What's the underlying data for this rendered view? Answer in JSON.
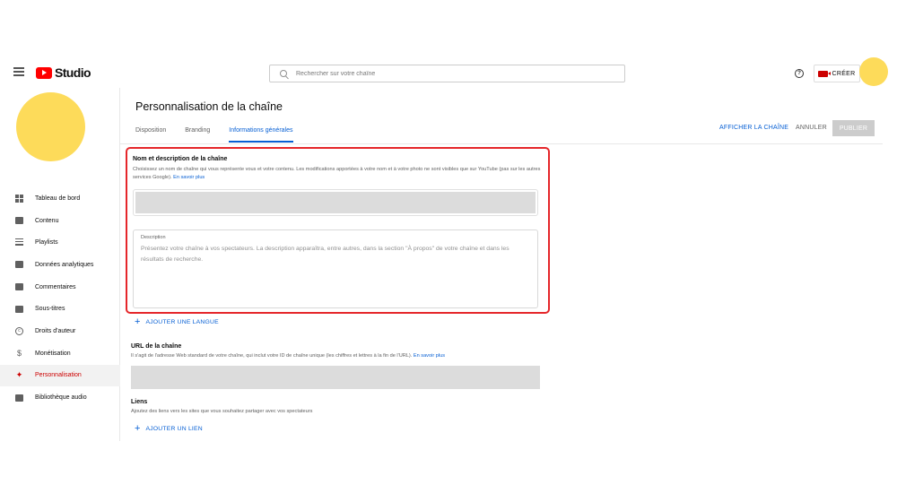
{
  "header": {
    "logo_text": "Studio",
    "search_placeholder": "Rechercher sur votre chaîne",
    "help_glyph": "?",
    "create_label": "CRÉER"
  },
  "sidebar": {
    "items": [
      {
        "label": "Tableau de bord",
        "icon": "dashboard-icon"
      },
      {
        "label": "Contenu",
        "icon": "content-icon"
      },
      {
        "label": "Playlists",
        "icon": "playlists-icon"
      },
      {
        "label": "Données analytiques",
        "icon": "analytics-icon"
      },
      {
        "label": "Commentaires",
        "icon": "comments-icon"
      },
      {
        "label": "Sous-titres",
        "icon": "subtitles-icon"
      },
      {
        "label": "Droits d'auteur",
        "icon": "copyright-icon"
      },
      {
        "label": "Monétisation",
        "icon": "dollar-icon"
      },
      {
        "label": "Personnalisation",
        "icon": "magic-wand-icon",
        "active": true
      },
      {
        "label": "Bibliothèque audio",
        "icon": "audio-library-icon"
      }
    ]
  },
  "page": {
    "title": "Personnalisation de la chaîne",
    "tabs": [
      {
        "label": "Disposition"
      },
      {
        "label": "Branding"
      },
      {
        "label": "Informations générales",
        "active": true
      }
    ],
    "view_channel_label": "AFFICHER LA CHAÎNE",
    "cancel_label": "ANNULER",
    "publish_label": "PUBLIER"
  },
  "name_section": {
    "title": "Nom et description de la chaîne",
    "description": "Choisissez un nom de chaîne qui vous représente vous et votre contenu. Les modifications apportées à votre nom et à votre photo ne sont visibles que sur YouTube (pas sur les autres services Google).",
    "learn_more": "En savoir plus",
    "description_label": "Description",
    "description_placeholder": "Présentez votre chaîne à vos spectateurs. La description apparaîtra, entre autres, dans la section \"À propos\" de votre chaîne et dans les résultats de recherche."
  },
  "add_language_label": "AJOUTER UNE LANGUE",
  "url_section": {
    "title": "URL de la chaîne",
    "description": "Il s'agit de l'adresse Web standard de votre chaîne, qui inclut votre ID de chaîne unique (les chiffres et lettres à la fin de l'URL).",
    "learn_more": "En savoir plus"
  },
  "links_section": {
    "title": "Liens",
    "description": "Ajoutez des liens vers les sites que vous souhaitez partager avec vos spectateurs",
    "add_link_label": "AJOUTER UN LIEN"
  },
  "colors": {
    "accent": "#065fd4",
    "brand_red": "#ff0000",
    "highlight": "#e5262a",
    "avatar": "#fddb5a",
    "redacted": "#dcdcdc"
  }
}
